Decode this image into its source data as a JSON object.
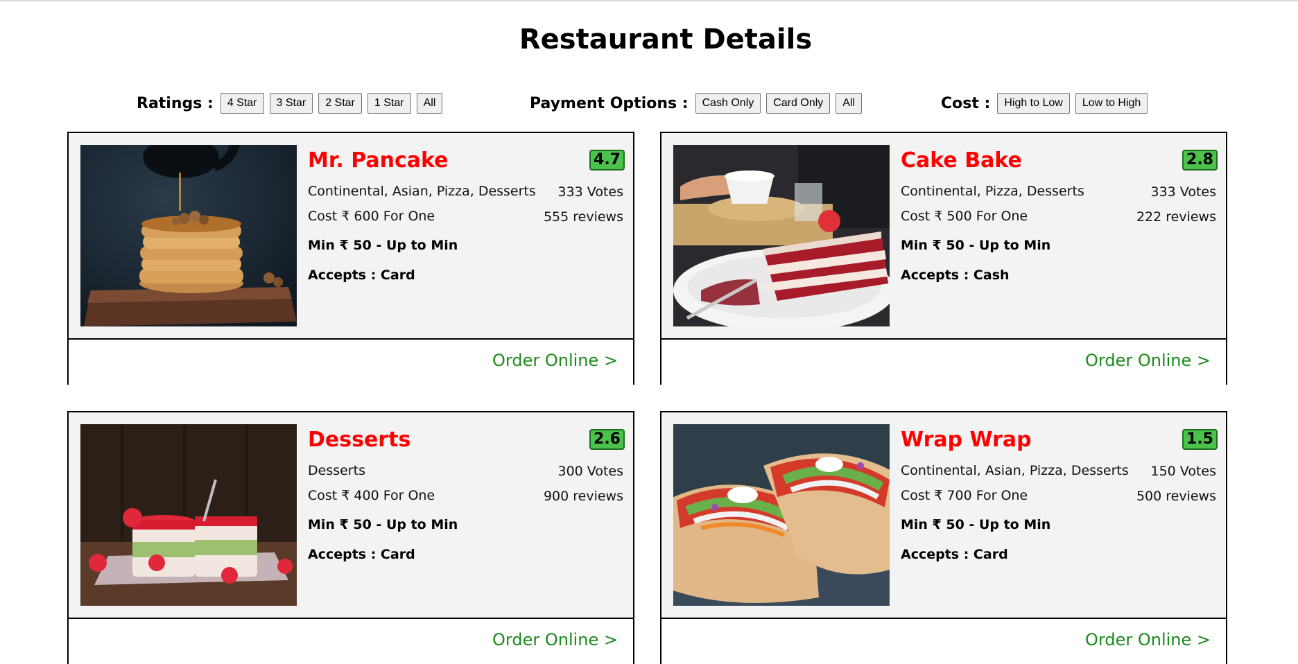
{
  "page": {
    "title": "Restaurant Details"
  },
  "filters": {
    "ratings": {
      "label": "Ratings :",
      "options": [
        "4 Star",
        "3 Star",
        "2 Star",
        "1 Star",
        "All"
      ]
    },
    "payment": {
      "label": "Payment Options :",
      "options": [
        "Cash Only",
        "Card Only",
        "All"
      ]
    },
    "cost": {
      "label": "Cost :",
      "options": [
        "High to Low",
        "Low to High"
      ]
    }
  },
  "restaurants": [
    {
      "name": "Mr. Pancake",
      "rating": "4.7",
      "cuisines": "Continental, Asian, Pizza, Desserts",
      "votes": "333 Votes",
      "cost": "Cost ₹ 600 For One",
      "reviews": "555 reviews",
      "min": "Min ₹ 50 - Up to Min",
      "accepts": "Accepts : Card",
      "order": "Order Online >",
      "image": "pancake-photo"
    },
    {
      "name": "Cake Bake",
      "rating": "2.8",
      "cuisines": "Continental, Pizza, Desserts",
      "votes": "333 Votes",
      "cost": "Cost ₹ 500 For One",
      "reviews": "222 reviews",
      "min": "Min ₹ 50 - Up to Min",
      "accepts": "Accepts : Cash",
      "order": "Order Online >",
      "image": "cake-photo"
    },
    {
      "name": "Desserts",
      "rating": "2.6",
      "cuisines": "Desserts",
      "votes": "300 Votes",
      "cost": "Cost ₹ 400 For One",
      "reviews": "900 reviews",
      "min": "Min ₹ 50 - Up to Min",
      "accepts": "Accepts : Card",
      "order": "Order Online >",
      "image": "dessert-cups-photo"
    },
    {
      "name": "Wrap Wrap",
      "rating": "1.5",
      "cuisines": "Continental, Asian, Pizza, Desserts",
      "votes": "150 Votes",
      "cost": "Cost ₹ 700 For One",
      "reviews": "500 reviews",
      "min": "Min ₹ 50 - Up to Min",
      "accepts": "Accepts : Card",
      "order": "Order Online >",
      "image": "tacos-photo"
    }
  ],
  "colors": {
    "restaurant_name": "#ff0000",
    "rating_badge": "#4cc24c",
    "order_link": "#1b8a1b",
    "card_background": "#f3f3f3"
  }
}
